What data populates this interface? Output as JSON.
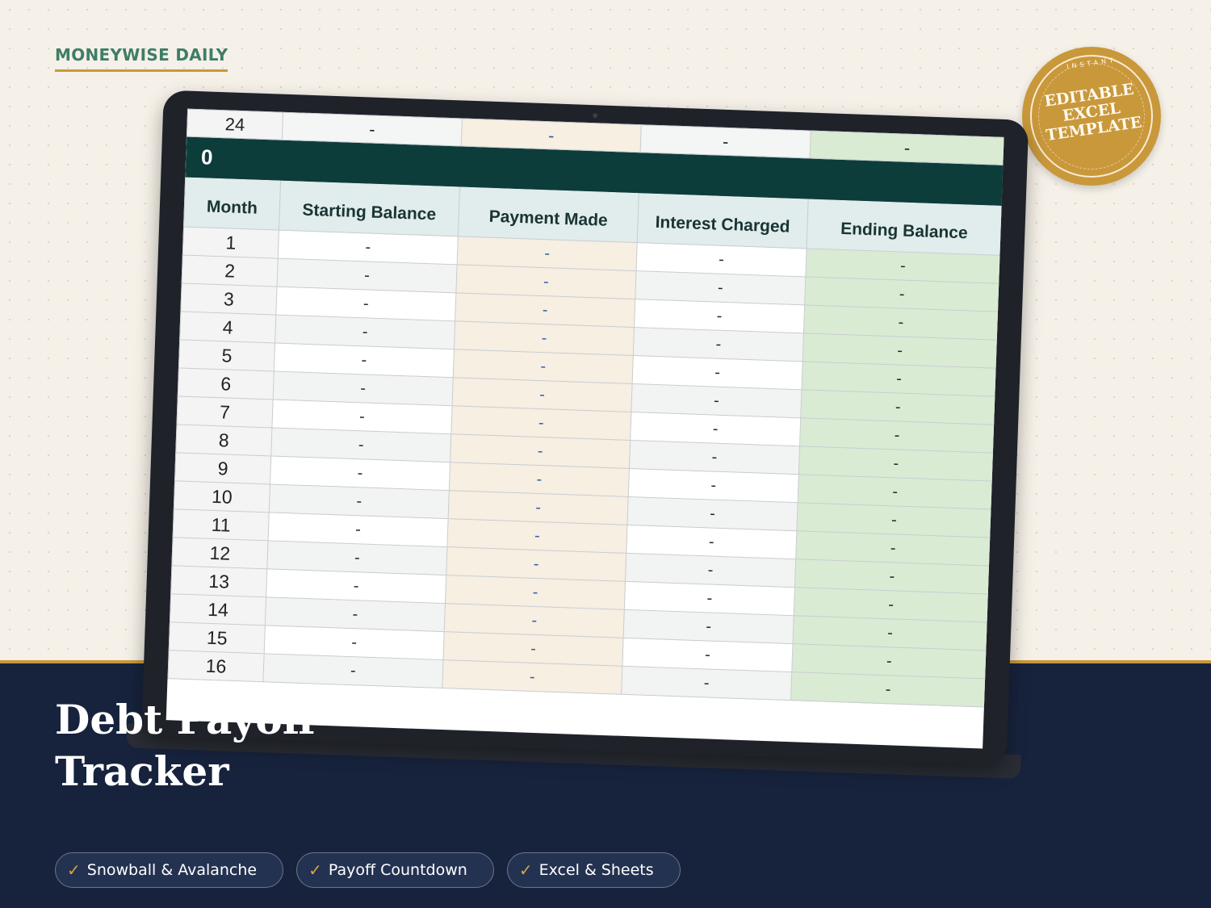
{
  "brand": "MONEYWISE DAILY",
  "badge": {
    "arc_text": "INSTANT",
    "lines": [
      "EDITABLE",
      "EXCEL",
      "TEMPLATE"
    ]
  },
  "sheet": {
    "prev_row": {
      "month": "24",
      "starting_balance": "-",
      "payment_made": "-",
      "interest_charged": "-",
      "ending_balance": "-"
    },
    "total_value": "0",
    "headers": [
      "Month",
      "Starting Balance",
      "Payment Made",
      "Interest Charged",
      "Ending Balance"
    ],
    "rows": [
      {
        "month": "1",
        "sb": "-",
        "pm": "-",
        "ic": "-",
        "eb": "-"
      },
      {
        "month": "2",
        "sb": "-",
        "pm": "-",
        "ic": "-",
        "eb": "-"
      },
      {
        "month": "3",
        "sb": "-",
        "pm": "-",
        "ic": "-",
        "eb": "-"
      },
      {
        "month": "4",
        "sb": "-",
        "pm": "-",
        "ic": "-",
        "eb": "-"
      },
      {
        "month": "5",
        "sb": "-",
        "pm": "-",
        "ic": "-",
        "eb": "-"
      },
      {
        "month": "6",
        "sb": "-",
        "pm": "-",
        "ic": "-",
        "eb": "-"
      },
      {
        "month": "7",
        "sb": "-",
        "pm": "-",
        "ic": "-",
        "eb": "-"
      },
      {
        "month": "8",
        "sb": "-",
        "pm": "-",
        "ic": "-",
        "eb": "-"
      },
      {
        "month": "9",
        "sb": "-",
        "pm": "-",
        "ic": "-",
        "eb": "-"
      },
      {
        "month": "10",
        "sb": "-",
        "pm": "-",
        "ic": "-",
        "eb": "-"
      },
      {
        "month": "11",
        "sb": "-",
        "pm": "-",
        "ic": "-",
        "eb": "-"
      },
      {
        "month": "12",
        "sb": "-",
        "pm": "-",
        "ic": "-",
        "eb": "-"
      },
      {
        "month": "13",
        "sb": "-",
        "pm": "-",
        "ic": "-",
        "eb": "-"
      },
      {
        "month": "14",
        "sb": "-",
        "pm": "-",
        "ic": "-",
        "eb": "-"
      },
      {
        "month": "15",
        "sb": "-",
        "pm": "-",
        "ic": "-",
        "eb": "-"
      },
      {
        "month": "16",
        "sb": "-",
        "pm": "-",
        "ic": "-",
        "eb": "-"
      }
    ]
  },
  "title": {
    "line1": "Debt Payoff",
    "line2": "Tracker"
  },
  "chips": [
    {
      "icon": "check-icon",
      "label": "Snowball & Avalanche"
    },
    {
      "icon": "check-icon",
      "label": "Payoff Countdown"
    },
    {
      "icon": "check-icon",
      "label": "Excel & Sheets"
    }
  ],
  "colors": {
    "background": "#f5f1e8",
    "brand_green": "#3f7d68",
    "gold": "#c9983b",
    "navy": "#17233d",
    "sheet_dark_green": "#0d3d3a",
    "payment_column": "#f6efe2",
    "ending_balance_column": "#d9ebd3"
  }
}
